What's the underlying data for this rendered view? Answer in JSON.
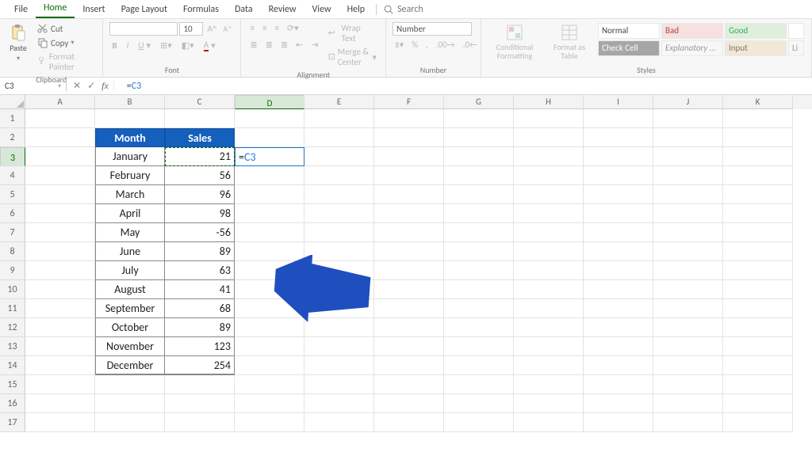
{
  "tabs": [
    "File",
    "Home",
    "Insert",
    "Page Layout",
    "Formulas",
    "Data",
    "Review",
    "View",
    "Help"
  ],
  "active_tab": "Home",
  "search_label": "Search",
  "clipboard": {
    "paste": "Paste",
    "cut": "Cut",
    "copy": "Copy",
    "fp": "Format Painter",
    "label": "Clipboard"
  },
  "font": {
    "size": "10",
    "label": "Font"
  },
  "alignment": {
    "wrap": "Wrap Text",
    "merge": "Merge & Center",
    "label": "Alignment"
  },
  "number": {
    "format": "Number",
    "label": "Number"
  },
  "styles": {
    "cf": "Conditional Formatting",
    "fat": "Format as Table",
    "cells": [
      [
        "Normal",
        "Bad",
        "Good",
        ""
      ],
      [
        "Check Cell",
        "Explanatory ...",
        "Input",
        "Li"
      ]
    ],
    "label": "Styles"
  },
  "namebox": "C3",
  "formula_eq": "=",
  "formula_ref": "C3",
  "columns": [
    "A",
    "B",
    "C",
    "D",
    "E",
    "F",
    "G",
    "H",
    "I",
    "J",
    "K"
  ],
  "header": {
    "month": "Month",
    "sales": "Sales"
  },
  "data": [
    {
      "m": "January",
      "s": "21"
    },
    {
      "m": "February",
      "s": "56"
    },
    {
      "m": "March",
      "s": "96"
    },
    {
      "m": "April",
      "s": "98"
    },
    {
      "m": "May",
      "s": "-56"
    },
    {
      "m": "June",
      "s": "89"
    },
    {
      "m": "July",
      "s": "63"
    },
    {
      "m": "August",
      "s": "41"
    },
    {
      "m": "September",
      "s": "68"
    },
    {
      "m": "October",
      "s": "89"
    },
    {
      "m": "November",
      "s": "123"
    },
    {
      "m": "December",
      "s": "254"
    }
  ],
  "active_cell_row": 3,
  "selected_col": "D"
}
